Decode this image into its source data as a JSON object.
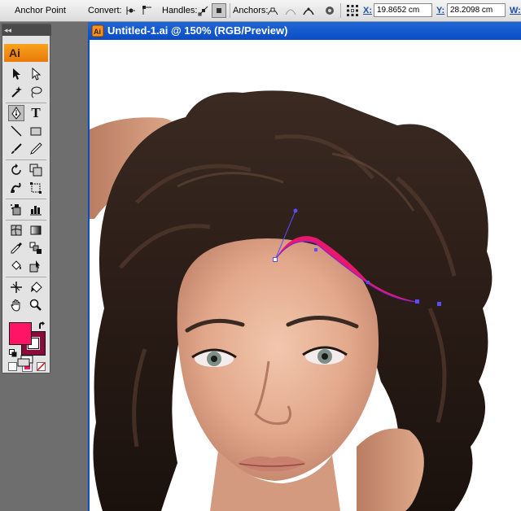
{
  "control_bar": {
    "tool_name": "Anchor Point",
    "convert_label": "Convert:",
    "handles_label": "Handles:",
    "anchors_label": "Anchors:",
    "x_label": "X:",
    "x_value": "19.8652 cm",
    "y_label": "Y:",
    "y_value": "28.2098 cm",
    "w_label": "W:"
  },
  "tools_panel": {
    "grip": "◂◂",
    "logo": "Ai",
    "type_tool_glyph": "T",
    "selected_tool": "pen-tool"
  },
  "colors": {
    "fill": "#ff1466",
    "stroke": "#8a0a3a",
    "path": "#e6196e",
    "handle": "#5a4cff",
    "accent": "#0a4cc4"
  },
  "document": {
    "title": "Untitled-1.ai @ 150% (RGB/Preview)",
    "zoom": "150%",
    "color_mode": "RGB/Preview"
  }
}
